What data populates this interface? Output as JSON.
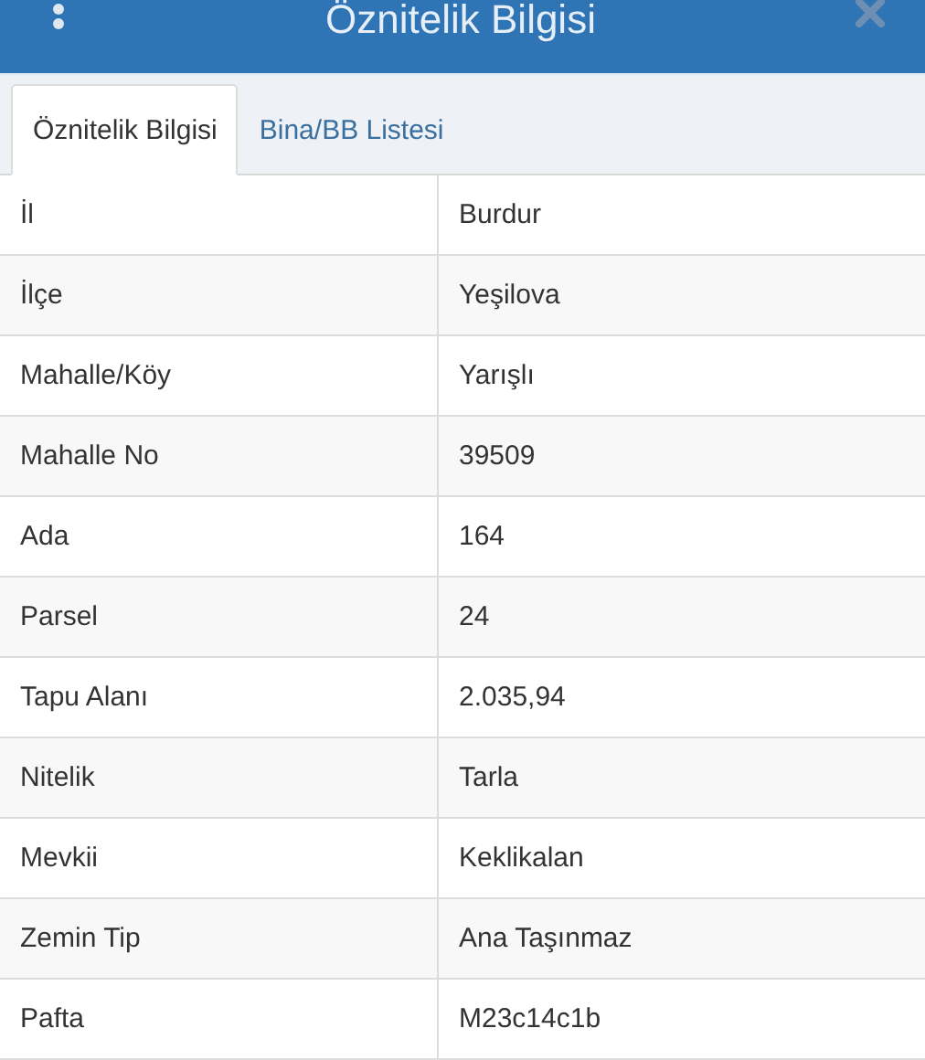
{
  "header": {
    "title": "Öznitelik Bilgisi"
  },
  "tabs": [
    {
      "label": "Öznitelik Bilgisi",
      "selected": true
    },
    {
      "label": "Bina/BB Listesi",
      "selected": false
    }
  ],
  "table": {
    "rows": [
      [
        "İl",
        "Burdur"
      ],
      [
        "İlçe",
        "Yeşilova"
      ],
      [
        "Mahalle/Köy",
        "Yarışlı"
      ],
      [
        "Mahalle No",
        "39509"
      ],
      [
        "Ada",
        "164"
      ],
      [
        "Parsel",
        "24"
      ],
      [
        "Tapu Alanı",
        "2.035,94"
      ],
      [
        "Nitelik",
        "Tarla"
      ],
      [
        "Mevkii",
        "Keklikalan"
      ],
      [
        "Zemin Tip",
        "Ana Taşınmaz"
      ],
      [
        "Pafta",
        "M23c14c1b"
      ]
    ]
  }
}
